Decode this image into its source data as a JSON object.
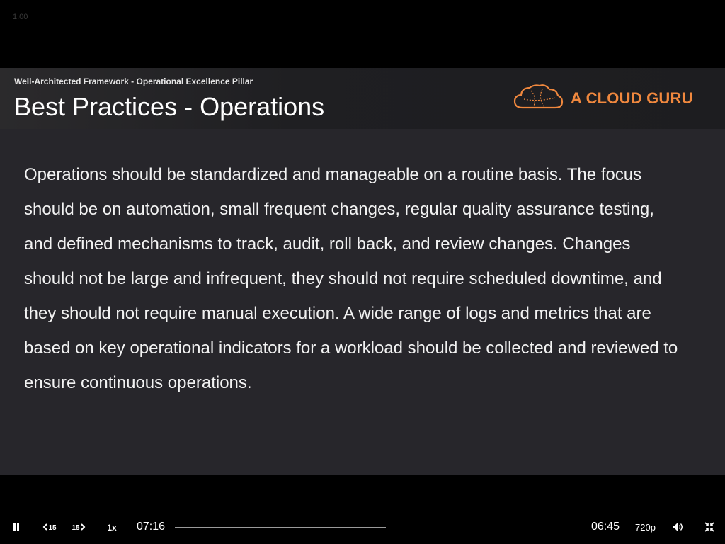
{
  "player": {
    "speed_overlay": "1.00"
  },
  "slide": {
    "subtitle": "Well-Architected Framework - Operational Excellence Pillar",
    "title": "Best Practices - Operations",
    "brand_text": "A CLOUD GURU",
    "brand_color": "#f0883e",
    "body": "Operations should be standardized and manageable on a routine basis. The focus should be on automation, small frequent changes, regular quality assurance testing, and defined mechanisms to track, audit, roll back, and review changes. Changes should not be large and infrequent, they should not require scheduled downtime, and they should not require manual execution. A wide range of logs and metrics that are based on key operational indicators for a workload should be collected and reviewed to ensure continuous operations."
  },
  "controls": {
    "rewind_label": "15",
    "forward_label": "15",
    "speed_label": "1x",
    "elapsed": "07:16",
    "remaining": "06:45",
    "quality": "720p",
    "progress_fraction": 0.0
  },
  "icons": {
    "pause": "pause-icon",
    "rewind": "rewind-15-icon",
    "forward": "forward-15-icon",
    "volume": "volume-icon",
    "exit_fullscreen": "exit-fullscreen-icon",
    "logo": "cloud-logo-icon"
  }
}
